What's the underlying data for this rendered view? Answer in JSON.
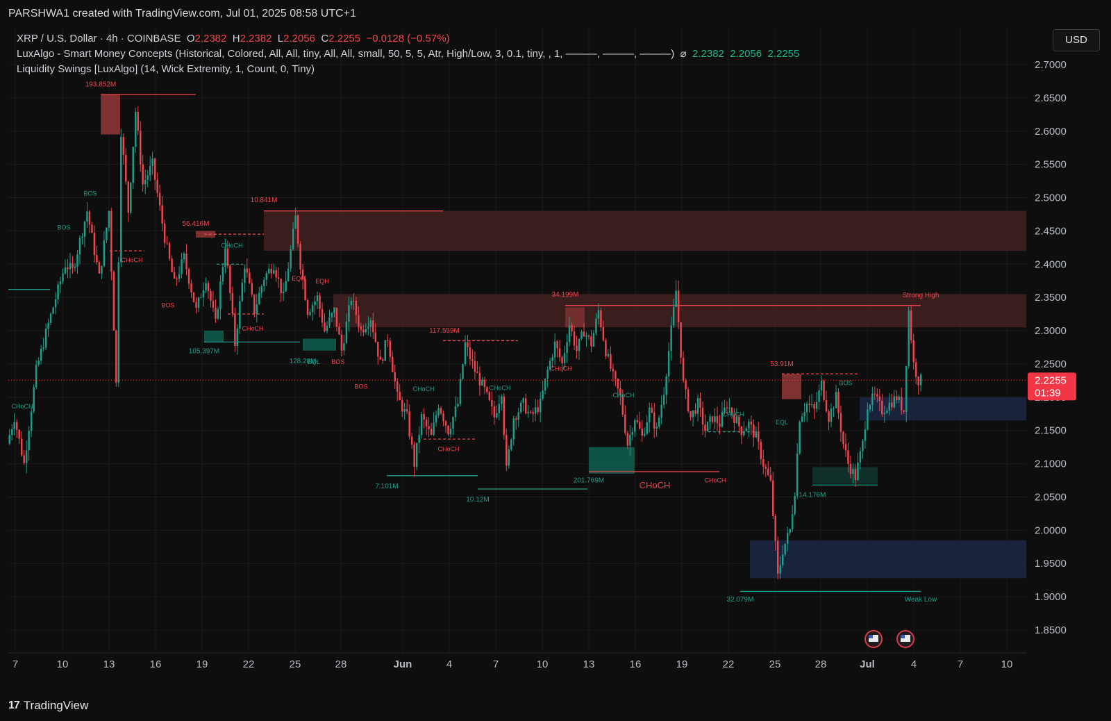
{
  "header": {
    "caption": "PARSHWA1 created with TradingView.com, Jul 01, 2025 08:58 UTC+1"
  },
  "legend": {
    "symbol_line_prefix": "XRP / U.S. Dollar · 4h · COINBASE",
    "open_label": "O",
    "open": "2.2382",
    "high_label": "H",
    "high": "2.2382",
    "low_label": "L",
    "low": "2.2056",
    "close_label": "C",
    "close": "2.2255",
    "change": "−0.0128 (−0.57%)",
    "indicator1": "LuxAlgo - Smart Money Concepts (Historical, Colored, All, All, tiny, All, All, small, 50, 5, 5, Atr, High/Low, 3, 0.1, tiny, , 1, ———, ———, ———)",
    "indicator1_icon": "hidden-eye-icon",
    "indicator1_values": [
      "2.2382",
      "2.2056",
      "2.2255"
    ],
    "indicator2": "Liquidity Swings [LuxAlgo] (14, Wick Extremity, 1, Count, 0, Tiny)"
  },
  "currency_button": "USD",
  "price_tag": {
    "price": "2.2255",
    "countdown": "01:39"
  },
  "footer": {
    "brand": "TradingView"
  },
  "colors": {
    "background": "#0e0e0e",
    "up": "#1f9e89",
    "down": "#f0454f",
    "bear_zone": "#4a2424",
    "bull_zone": "#1c2744",
    "grid": "#1b1b1b"
  },
  "chart_data": {
    "type": "candlestick",
    "timeframe": "4h",
    "y_axis": {
      "ticks": [
        "2.7000",
        "2.6500",
        "2.6000",
        "2.5500",
        "2.5000",
        "2.4500",
        "2.4000",
        "2.3500",
        "2.3000",
        "2.2500",
        "2.2000",
        "2.1500",
        "2.1000",
        "2.0500",
        "2.0000",
        "1.9500",
        "1.9000",
        "1.8500"
      ],
      "range": [
        1.82,
        2.72
      ]
    },
    "x_axis": {
      "ticks": [
        "7",
        "10",
        "13",
        "16",
        "19",
        "22",
        "25",
        "28",
        "Jun",
        "4",
        "7",
        "10",
        "13",
        "16",
        "19",
        "22",
        "25",
        "28",
        "Jul",
        "4",
        "7",
        "10"
      ]
    },
    "current_price": 2.2255,
    "price_path": [
      [
        0,
        2.13
      ],
      [
        3,
        2.17
      ],
      [
        7,
        2.1
      ],
      [
        12,
        2.24
      ],
      [
        17,
        2.31
      ],
      [
        24,
        2.4
      ],
      [
        27,
        2.39
      ],
      [
        33,
        2.48
      ],
      [
        38,
        2.38
      ],
      [
        42,
        2.48
      ],
      [
        45,
        2.22
      ],
      [
        47,
        2.6
      ],
      [
        50,
        2.48
      ],
      [
        53,
        2.63
      ],
      [
        56,
        2.52
      ],
      [
        60,
        2.55
      ],
      [
        65,
        2.44
      ],
      [
        69,
        2.37
      ],
      [
        73,
        2.41
      ],
      [
        78,
        2.33
      ],
      [
        82,
        2.38
      ],
      [
        86,
        2.31
      ],
      [
        90,
        2.43
      ],
      [
        94,
        2.28
      ],
      [
        98,
        2.4
      ],
      [
        102,
        2.33
      ],
      [
        106,
        2.38
      ],
      [
        110,
        2.4
      ],
      [
        114,
        2.35
      ],
      [
        117,
        2.42
      ],
      [
        119,
        2.47
      ],
      [
        121,
        2.4
      ],
      [
        124,
        2.33
      ],
      [
        128,
        2.35
      ],
      [
        131,
        2.3
      ],
      [
        135,
        2.33
      ],
      [
        138,
        2.27
      ],
      [
        142,
        2.35
      ],
      [
        146,
        2.3
      ],
      [
        150,
        2.32
      ],
      [
        154,
        2.25
      ],
      [
        157,
        2.29
      ],
      [
        161,
        2.2
      ],
      [
        165,
        2.17
      ],
      [
        168,
        2.1
      ],
      [
        171,
        2.17
      ],
      [
        175,
        2.14
      ],
      [
        178,
        2.19
      ],
      [
        182,
        2.15
      ],
      [
        186,
        2.19
      ],
      [
        189,
        2.28
      ],
      [
        193,
        2.24
      ],
      [
        197,
        2.21
      ],
      [
        201,
        2.17
      ],
      [
        204,
        2.21
      ],
      [
        206,
        2.09
      ],
      [
        209,
        2.17
      ],
      [
        213,
        2.19
      ],
      [
        216,
        2.17
      ],
      [
        220,
        2.19
      ],
      [
        223,
        2.24
      ],
      [
        226,
        2.28
      ],
      [
        229,
        2.25
      ],
      [
        232,
        2.31
      ],
      [
        235,
        2.27
      ],
      [
        238,
        2.3
      ],
      [
        241,
        2.28
      ],
      [
        244,
        2.33
      ],
      [
        247,
        2.27
      ],
      [
        250,
        2.23
      ],
      [
        253,
        2.2
      ],
      [
        256,
        2.13
      ],
      [
        259,
        2.17
      ],
      [
        262,
        2.14
      ],
      [
        265,
        2.18
      ],
      [
        268,
        2.15
      ],
      [
        271,
        2.21
      ],
      [
        274,
        2.3
      ],
      [
        276,
        2.36
      ],
      [
        279,
        2.22
      ],
      [
        282,
        2.17
      ],
      [
        285,
        2.19
      ],
      [
        288,
        2.15
      ],
      [
        291,
        2.17
      ],
      [
        294,
        2.16
      ],
      [
        297,
        2.19
      ],
      [
        300,
        2.17
      ],
      [
        303,
        2.15
      ],
      [
        306,
        2.16
      ],
      [
        309,
        2.14
      ],
      [
        312,
        2.1
      ],
      [
        315,
        2.07
      ],
      [
        318,
        1.93
      ],
      [
        320,
        1.97
      ],
      [
        323,
        2.0
      ],
      [
        325,
        2.06
      ],
      [
        327,
        2.17
      ],
      [
        330,
        2.19
      ],
      [
        333,
        2.18
      ],
      [
        336,
        2.22
      ],
      [
        339,
        2.17
      ],
      [
        342,
        2.2
      ],
      [
        345,
        2.13
      ],
      [
        347,
        2.1
      ],
      [
        350,
        2.08
      ],
      [
        353,
        2.13
      ],
      [
        355,
        2.19
      ],
      [
        358,
        2.2
      ],
      [
        361,
        2.18
      ],
      [
        364,
        2.19
      ],
      [
        367,
        2.2
      ],
      [
        370,
        2.18
      ],
      [
        372,
        2.33
      ],
      [
        374,
        2.25
      ],
      [
        376,
        2.2255
      ]
    ],
    "zones": [
      {
        "kind": "supply",
        "top": 2.48,
        "bottom": 2.42
      },
      {
        "kind": "supply",
        "top": 2.355,
        "bottom": 2.305
      },
      {
        "kind": "demand",
        "top": 2.2,
        "bottom": 2.165
      },
      {
        "kind": "demand",
        "top": 1.985,
        "bottom": 1.928
      }
    ],
    "annotations": [
      {
        "text": "193.852M",
        "type": "volume"
      },
      {
        "text": "10.841M",
        "type": "volume"
      },
      {
        "text": "56.416M",
        "type": "volume"
      },
      {
        "text": "34.199M",
        "type": "volume"
      },
      {
        "text": "117.559M",
        "type": "volume"
      },
      {
        "text": "53.91M",
        "type": "volume"
      },
      {
        "text": "105.397M",
        "type": "volume"
      },
      {
        "text": "128.28M",
        "type": "volume"
      },
      {
        "text": "7.101M",
        "type": "volume"
      },
      {
        "text": "10.12M",
        "type": "volume"
      },
      {
        "text": "201.769M",
        "type": "volume"
      },
      {
        "text": "14.176M",
        "type": "volume"
      },
      {
        "text": "32.079M",
        "type": "volume"
      },
      {
        "text": "Strong High",
        "type": "label"
      },
      {
        "text": "Weak Low",
        "type": "label"
      },
      {
        "text": "BOS",
        "type": "structure"
      },
      {
        "text": "CHoCH",
        "type": "structure"
      },
      {
        "text": "EQH",
        "type": "structure"
      },
      {
        "text": "EQL",
        "type": "structure"
      }
    ]
  }
}
